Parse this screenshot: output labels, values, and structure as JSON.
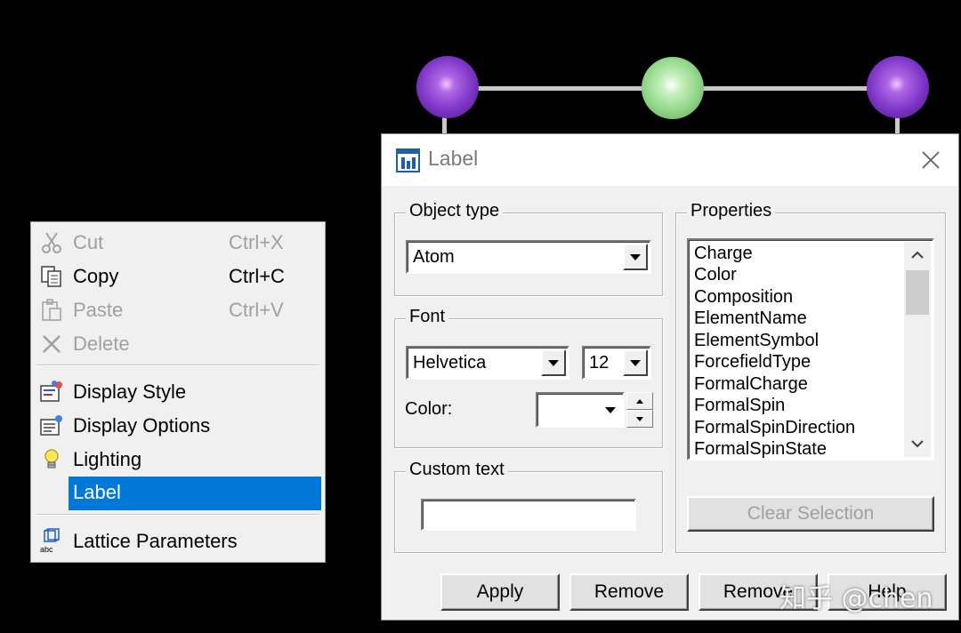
{
  "context_menu": {
    "items": [
      {
        "label": "Cut",
        "shortcut": "Ctrl+X",
        "enabled": false,
        "icon": "scissors-icon"
      },
      {
        "label": "Copy",
        "shortcut": "Ctrl+C",
        "enabled": true,
        "icon": "copy-icon"
      },
      {
        "label": "Paste",
        "shortcut": "Ctrl+V",
        "enabled": false,
        "icon": "paste-icon"
      },
      {
        "label": "Delete",
        "shortcut": "",
        "enabled": false,
        "icon": "delete-icon"
      },
      {
        "label": "Display Style",
        "enabled": true,
        "icon": "display-style-icon"
      },
      {
        "label": "Display Options",
        "enabled": true,
        "icon": "display-options-icon"
      },
      {
        "label": "Lighting",
        "enabled": true,
        "icon": "lightbulb-icon"
      },
      {
        "label": "Label",
        "enabled": true,
        "selected": true
      },
      {
        "label": "Lattice Parameters",
        "enabled": true,
        "icon": "lattice-parameters-icon"
      }
    ]
  },
  "dialog": {
    "title": "Label",
    "icon": "app-icon",
    "object_type": {
      "title": "Object type",
      "value": "Atom"
    },
    "font": {
      "title": "Font",
      "family": "Helvetica",
      "size": "12",
      "color_label": "Color:",
      "color_value": ""
    },
    "custom_text": {
      "title": "Custom text",
      "value": ""
    },
    "properties": {
      "title": "Properties",
      "items": [
        "Charge",
        "Color",
        "Composition",
        "ElementName",
        "ElementSymbol",
        "ForcefieldType",
        "FormalCharge",
        "FormalSpin",
        "FormalSpinDirection",
        "FormalSpinState"
      ],
      "clear_button": "Clear Selection"
    },
    "buttons": {
      "apply": "Apply",
      "remove": "Remove",
      "remove_all": "Remove",
      "help": "Help"
    }
  },
  "colors": {
    "selection": "#0078d7",
    "atom_purple": "#8b3fd6",
    "atom_green": "#92d88a"
  },
  "watermark": "知乎 @chen"
}
